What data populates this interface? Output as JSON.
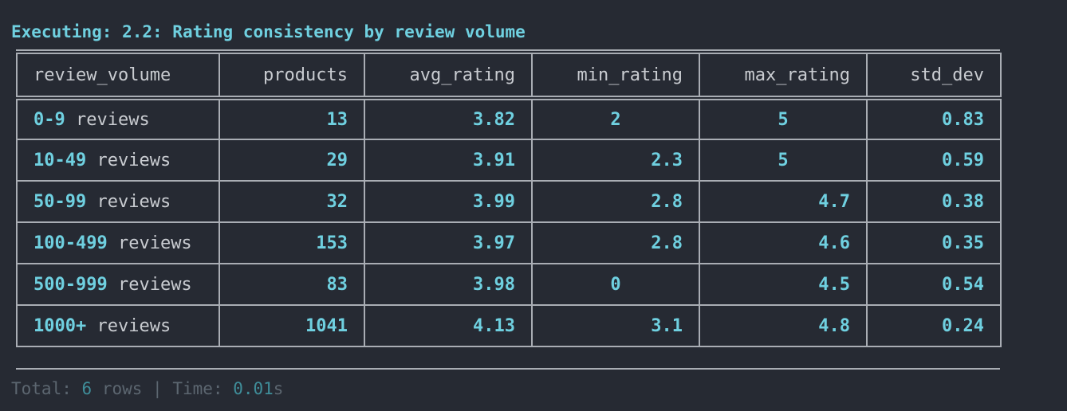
{
  "header": {
    "prefix": "Executing: ",
    "query_id": "2.2",
    "query_title": ": Rating consistency by review volume"
  },
  "table": {
    "columns": [
      "review_volume",
      "products",
      "avg_rating",
      "min_rating",
      "max_rating",
      "std_dev"
    ],
    "rows": [
      {
        "range": "0-9",
        "suffix": " reviews",
        "products": "13",
        "avg_rating": "3.82",
        "min_rating": "2",
        "max_rating": "5",
        "std_dev": "0.83"
      },
      {
        "range": "10-49",
        "suffix": " reviews",
        "products": "29",
        "avg_rating": "3.91",
        "min_rating": "2.3",
        "max_rating": "5",
        "std_dev": "0.59"
      },
      {
        "range": "50-99",
        "suffix": " reviews",
        "products": "32",
        "avg_rating": "3.99",
        "min_rating": "2.8",
        "max_rating": "4.7",
        "std_dev": "0.38"
      },
      {
        "range": "100-499",
        "suffix": " reviews",
        "products": "153",
        "avg_rating": "3.97",
        "min_rating": "2.8",
        "max_rating": "4.6",
        "std_dev": "0.35"
      },
      {
        "range": "500-999",
        "suffix": " reviews",
        "products": "83",
        "avg_rating": "3.98",
        "min_rating": "0",
        "max_rating": "4.5",
        "std_dev": "0.54"
      },
      {
        "range": "1000+",
        "suffix": " reviews",
        "products": "1041",
        "avg_rating": "4.13",
        "min_rating": "3.1",
        "max_rating": "4.8",
        "std_dev": "0.24"
      }
    ]
  },
  "footer": {
    "total_label": "Total: ",
    "row_count": "6",
    "rows_label": " rows | Time: ",
    "time_value": "0.01",
    "time_unit": "s"
  },
  "colors": {
    "background": "#262a33",
    "accent": "#6fd0e0",
    "header_text": "#c9ccd1",
    "muted": "#5c6670",
    "border": "#a9adb4"
  }
}
